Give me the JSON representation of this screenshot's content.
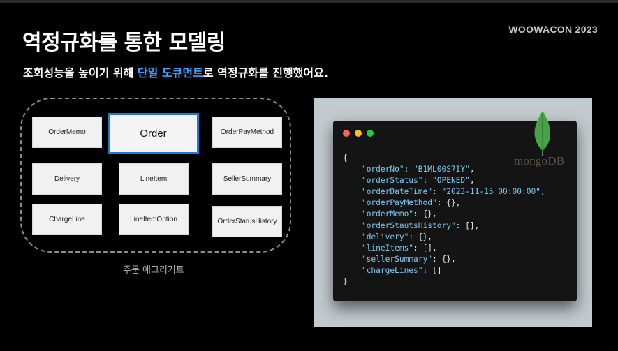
{
  "slide": {
    "title": "역정규화를 통한 모델링",
    "brand": "WOOWACON 2023",
    "subtitle_before": "조회성능을 높이기 위해 ",
    "subtitle_highlight": "단일 도큐먼트",
    "subtitle_after": "로 역정규화를 진행했어요.",
    "accent_color": "#3aa3ff"
  },
  "aggregate": {
    "caption": "주문 애그리거트",
    "entities": {
      "order_memo": "OrderMemo",
      "order": "Order",
      "order_pay_method": "OrderPayMethod",
      "delivery": "Delivery",
      "line_item": "LineItem",
      "seller_summary": "SellerSummary",
      "charge_line": "ChargeLine",
      "line_item_option": "LineItemOption",
      "order_status_history": "OrderStatusHistory"
    },
    "root_border_color": "#1e78d7"
  },
  "mongodb": {
    "logo_text": "mongoDB",
    "icon": "mongodb-leaf-icon"
  },
  "document": {
    "open_brace": "{",
    "close_brace": "}",
    "fields": [
      {
        "key": "\"orderNo\"",
        "value": "\"B1ML00S7IY\"",
        "trail": ","
      },
      {
        "key": "\"orderStatus\"",
        "value": "\"OPENED\"",
        "trail": ","
      },
      {
        "key": "\"orderDateTime\"",
        "value": "\"2023-11-15 00:00:00\"",
        "trail": ","
      },
      {
        "key": "\"orderPayMethod\"",
        "value": "{}",
        "trail": ","
      },
      {
        "key": "\"orderMemo\"",
        "value": "{}",
        "trail": ","
      },
      {
        "key": "\"orderStautsHistory\"",
        "value": "[]",
        "trail": ","
      },
      {
        "key": "\"delivery\"",
        "value": "{}",
        "trail": ","
      },
      {
        "key": "\"lineItems\"",
        "value": "[]",
        "trail": ","
      },
      {
        "key": "\"sellerSummary\"",
        "value": "{}",
        "trail": ","
      },
      {
        "key": "\"chargeLines\"",
        "value": "[]",
        "trail": ""
      }
    ]
  }
}
